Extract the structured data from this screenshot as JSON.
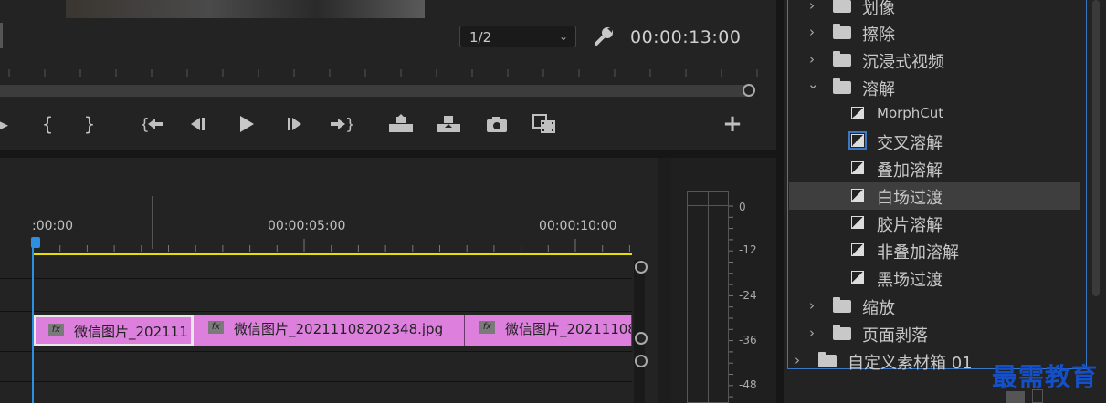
{
  "monitor": {
    "resolution": "1/2",
    "timecode": "00:00:13:00"
  },
  "transport": {
    "buttons": [
      "mark-in",
      "mark-out",
      "go-to-in",
      "step-back",
      "play",
      "step-forward",
      "go-to-out",
      "lift",
      "extract",
      "export-frame",
      "compare",
      "add"
    ]
  },
  "timeline": {
    "ruler_labels": [
      ":00:00",
      "00:00:05:00",
      "00:00:10:00"
    ],
    "clips": [
      {
        "name": "微信图片_202111"
      },
      {
        "name": "微信图片_20211108202348.jpg"
      },
      {
        "name": "微信图片_20211108"
      }
    ],
    "fx_label": "fx"
  },
  "meter": {
    "scale": [
      "0",
      "-12",
      "-24",
      "-36",
      "-48"
    ]
  },
  "effects": {
    "items": [
      {
        "type": "folder",
        "label": "划像",
        "expanded": false
      },
      {
        "type": "folder",
        "label": "擦除",
        "expanded": false
      },
      {
        "type": "folder",
        "label": "沉浸式视频",
        "expanded": false
      },
      {
        "type": "folder",
        "label": "溶解",
        "expanded": true
      },
      {
        "type": "transition",
        "label": "MorphCut"
      },
      {
        "type": "transition",
        "label": "交叉溶解",
        "default": true
      },
      {
        "type": "transition",
        "label": "叠加溶解"
      },
      {
        "type": "transition",
        "label": "白场过渡",
        "selected": true
      },
      {
        "type": "transition",
        "label": "胶片溶解"
      },
      {
        "type": "transition",
        "label": "非叠加溶解"
      },
      {
        "type": "transition",
        "label": "黑场过渡"
      },
      {
        "type": "folder",
        "label": "缩放",
        "expanded": false
      },
      {
        "type": "folder",
        "label": "页面剥落",
        "expanded": false
      }
    ],
    "custom_bin": "自定义素材箱 01"
  },
  "watermark": "最需教育",
  "colors": {
    "clip": "#dd80dd",
    "playhead": "#2e8ee0",
    "work_area": "#e6e000",
    "accent": "#3a78c6"
  }
}
